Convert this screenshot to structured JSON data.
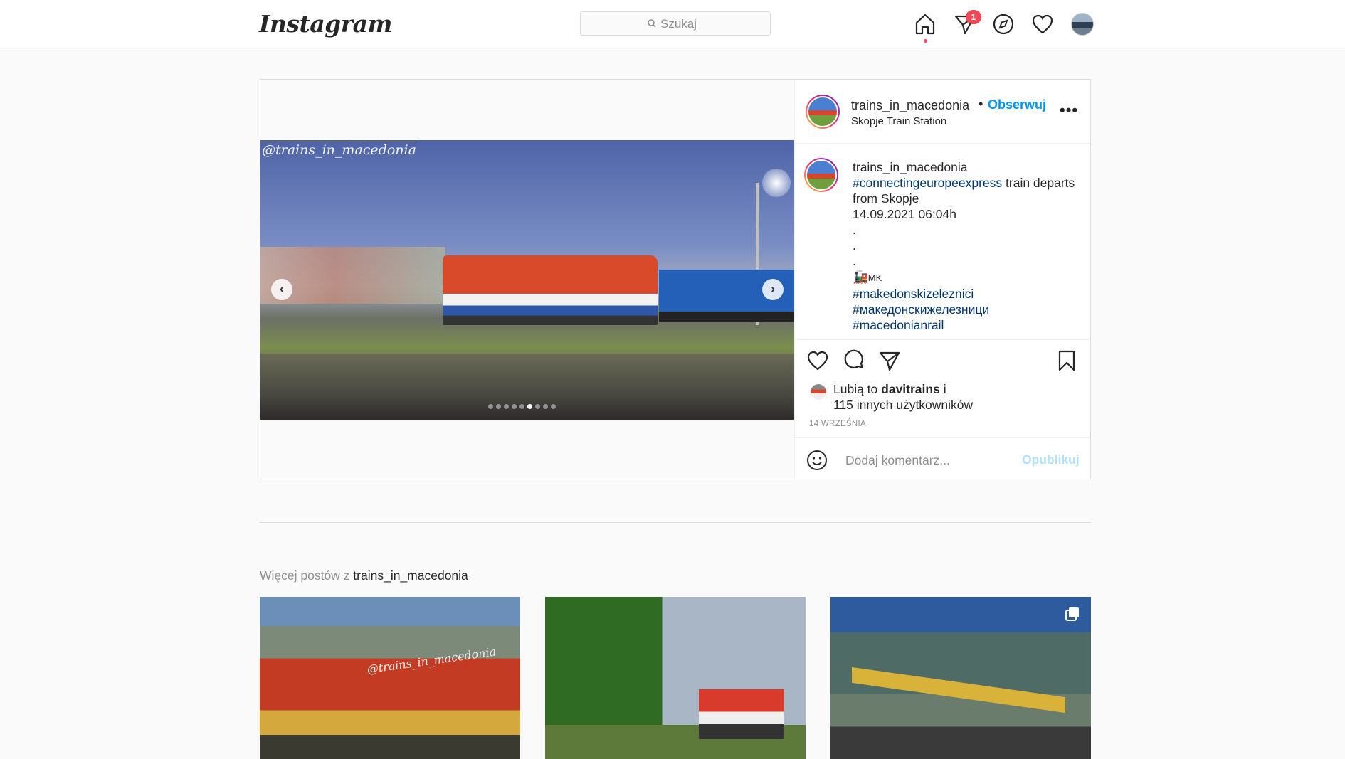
{
  "nav": {
    "logo": "Instagram",
    "search_placeholder": "Szukaj",
    "dm_badge": "1"
  },
  "post": {
    "username": "trains_in_macedonia",
    "follow_label": "Obserwuj",
    "location": "Skopje Train Station",
    "watermark": "@trains_in_macedonia",
    "carousel": {
      "count": 9,
      "active_index": 5
    },
    "caption": {
      "username": "trains_in_macedonia",
      "tag1": "#connectingeuropeexpress",
      "text1": " train departs from Skopje",
      "line2": "14.09.2021 06:04h",
      "dot1": ".",
      "dot2": ".",
      "dot3": ".",
      "flag": "MK",
      "tag2": "#makedonskizeleznici",
      "tag3": "#македонскижелезници",
      "tag4": "#macedonianrail"
    },
    "likes": {
      "prefix": "Lubią to ",
      "user": "davitrains",
      "suffix": " i",
      "others": "115 innych użytkowników"
    },
    "date": "14 WRZEŚNIA",
    "comment_placeholder": "Dodaj komentarz...",
    "publish_label": "Opublikuj"
  },
  "more_posts": {
    "prefix": "Więcej postów z ",
    "username": "trains_in_macedonia",
    "thumb_watermark": "@trains_in_macedonia"
  }
}
